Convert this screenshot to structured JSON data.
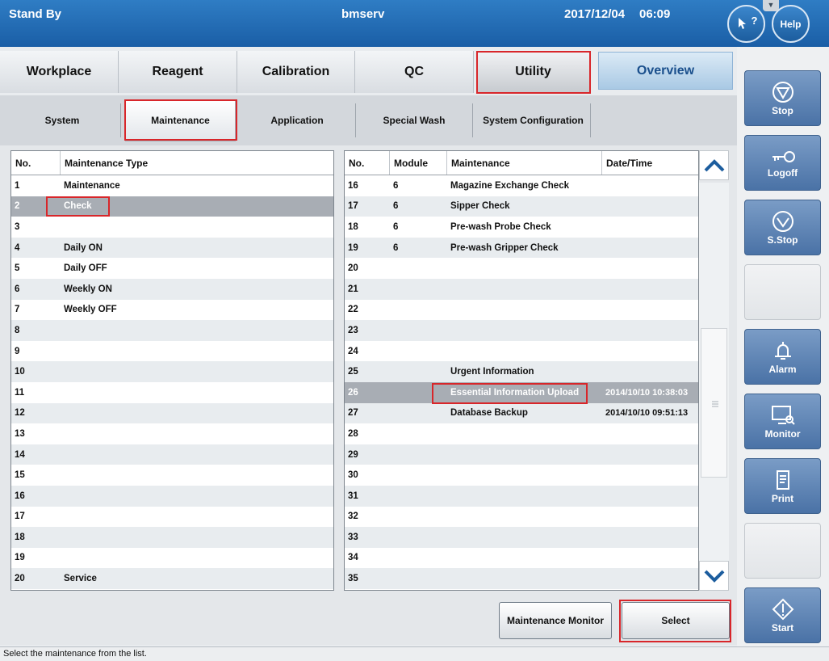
{
  "header": {
    "status": "Stand By",
    "user": "bmserv",
    "date": "2017/12/04",
    "time": "06:09",
    "help_cursor_label": "?",
    "help_label": "Help",
    "dropdown_icon": "▼"
  },
  "main_tabs": {
    "workplace": "Workplace",
    "reagent": "Reagent",
    "calibration": "Calibration",
    "qc": "QC",
    "utility": "Utility",
    "overview": "Overview",
    "active": "Utility"
  },
  "sub_tabs": {
    "system": "System",
    "maintenance": "Maintenance",
    "application": "Application",
    "special_wash": "Special Wash",
    "system_configuration": "System Configuration",
    "active": "Maintenance"
  },
  "left_table": {
    "headers": [
      "No.",
      "Maintenance Type"
    ],
    "rows": [
      {
        "no": "1",
        "type": "Maintenance"
      },
      {
        "no": "2",
        "type": "Check"
      },
      {
        "no": "3",
        "type": ""
      },
      {
        "no": "4",
        "type": "Daily ON"
      },
      {
        "no": "5",
        "type": "Daily OFF"
      },
      {
        "no": "6",
        "type": "Weekly ON"
      },
      {
        "no": "7",
        "type": "Weekly OFF"
      },
      {
        "no": "8",
        "type": ""
      },
      {
        "no": "9",
        "type": ""
      },
      {
        "no": "10",
        "type": ""
      },
      {
        "no": "11",
        "type": ""
      },
      {
        "no": "12",
        "type": ""
      },
      {
        "no": "13",
        "type": ""
      },
      {
        "no": "14",
        "type": ""
      },
      {
        "no": "15",
        "type": ""
      },
      {
        "no": "16",
        "type": ""
      },
      {
        "no": "17",
        "type": ""
      },
      {
        "no": "18",
        "type": ""
      },
      {
        "no": "19",
        "type": ""
      },
      {
        "no": "20",
        "type": "Service"
      }
    ],
    "selected_no": "2"
  },
  "right_table": {
    "headers": [
      "No.",
      "Module",
      "Maintenance",
      "Date/Time"
    ],
    "rows": [
      {
        "no": "16",
        "module": "6",
        "maintenance": "Magazine Exchange Check",
        "datetime": ""
      },
      {
        "no": "17",
        "module": "6",
        "maintenance": "Sipper Check",
        "datetime": ""
      },
      {
        "no": "18",
        "module": "6",
        "maintenance": "Pre-wash Probe Check",
        "datetime": ""
      },
      {
        "no": "19",
        "module": "6",
        "maintenance": "Pre-wash Gripper Check",
        "datetime": ""
      },
      {
        "no": "20",
        "module": "",
        "maintenance": "",
        "datetime": ""
      },
      {
        "no": "21",
        "module": "",
        "maintenance": "",
        "datetime": ""
      },
      {
        "no": "22",
        "module": "",
        "maintenance": "",
        "datetime": ""
      },
      {
        "no": "23",
        "module": "",
        "maintenance": "",
        "datetime": ""
      },
      {
        "no": "24",
        "module": "",
        "maintenance": "",
        "datetime": ""
      },
      {
        "no": "25",
        "module": "",
        "maintenance": "Urgent Information",
        "datetime": ""
      },
      {
        "no": "26",
        "module": "",
        "maintenance": "Essential Information Upload",
        "datetime": "2014/10/10 10:38:03"
      },
      {
        "no": "27",
        "module": "",
        "maintenance": "Database Backup",
        "datetime": "2014/10/10 09:51:13"
      },
      {
        "no": "28",
        "module": "",
        "maintenance": "",
        "datetime": ""
      },
      {
        "no": "29",
        "module": "",
        "maintenance": "",
        "datetime": ""
      },
      {
        "no": "30",
        "module": "",
        "maintenance": "",
        "datetime": ""
      },
      {
        "no": "31",
        "module": "",
        "maintenance": "",
        "datetime": ""
      },
      {
        "no": "32",
        "module": "",
        "maintenance": "",
        "datetime": ""
      },
      {
        "no": "33",
        "module": "",
        "maintenance": "",
        "datetime": ""
      },
      {
        "no": "34",
        "module": "",
        "maintenance": "",
        "datetime": ""
      },
      {
        "no": "35",
        "module": "",
        "maintenance": "",
        "datetime": ""
      }
    ],
    "selected_no": "26"
  },
  "buttons": {
    "maintenance_monitor": "Maintenance Monitor",
    "select": "Select"
  },
  "side_buttons": {
    "stop": "Stop",
    "logoff": "Logoff",
    "s_stop": "S.Stop",
    "alarm": "Alarm",
    "monitor": "Monitor",
    "print": "Print",
    "start": "Start"
  },
  "status_bar": "Select the maintenance from the list.",
  "colors": {
    "header_blue": "#1a5ea6",
    "selected_row": "#a8adb4",
    "highlight_red": "#d8262a",
    "side_button_blue": "#4a72a6"
  }
}
